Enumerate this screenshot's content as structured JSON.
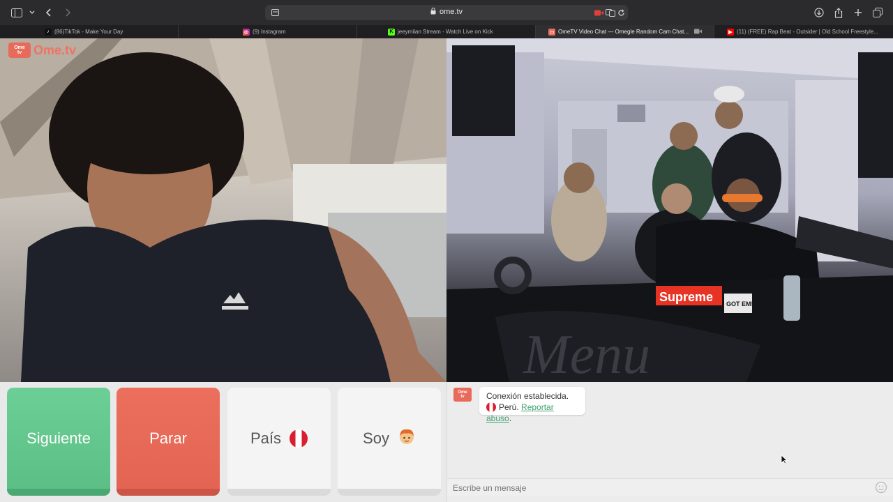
{
  "browser": {
    "url": "ome.tv",
    "tabs": [
      {
        "label": "(86)TikTok - Make Your Day",
        "icon": "tiktok-icon",
        "color": "#111111"
      },
      {
        "label": "(9) Instagram",
        "icon": "instagram-icon",
        "color": "#d6249f"
      },
      {
        "label": "jeeymilan Stream - Watch Live on Kick",
        "icon": "kick-icon",
        "color": "#53fc18"
      },
      {
        "label": "OmeTV Video Chat — Omegle Random Cam Chat...",
        "icon": "ometv-icon",
        "color": "#e86a5a",
        "active": true
      },
      {
        "label": "(11) (FREE) Rap Beat - Outsider | Old School Freestyle...",
        "icon": "youtube-icon",
        "color": "#ff0000"
      }
    ]
  },
  "video": {
    "logo_box": "Ome\ntv",
    "logo_text": "Ome.tv",
    "stranger_text": {
      "supreme": "Supreme",
      "gotem": "GOT EM!"
    }
  },
  "controls": {
    "next_label": "Siguiente",
    "stop_label": "Parar",
    "country_label": "País",
    "country_flag": "peru-flag-icon",
    "gender_label": "Soy",
    "gender_icon": "boy-emoji-icon"
  },
  "chat": {
    "status": "Conexión establecida.",
    "country": "Perú.",
    "report_link": "Reportar abuso",
    "after_link": ".",
    "placeholder": "Escribe un mensaje"
  },
  "colors": {
    "next": "#5cbf86",
    "stop": "#e36453",
    "link": "#3fa06f",
    "brand": "#e86a5a"
  }
}
